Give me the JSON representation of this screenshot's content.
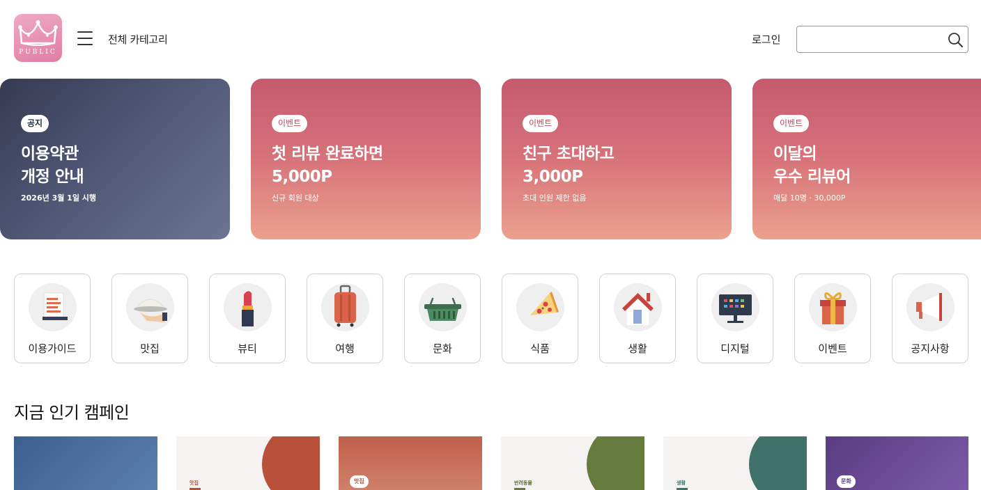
{
  "header": {
    "logo_text": "PUBLIC",
    "category_label": "전체 카테고리",
    "login_label": "로그인",
    "search_placeholder": ""
  },
  "banners": [
    {
      "type": "notice",
      "badge": "공지",
      "title_line1": "이용약관",
      "title_line2": "개정 안내",
      "subtitle": "2026년 3월 1일 시행"
    },
    {
      "type": "event",
      "badge": "이벤트",
      "title_line1": "첫 리뷰 완료하면",
      "title_line2": "5,000P",
      "subtitle": "신규 회원 대상"
    },
    {
      "type": "event",
      "badge": "이벤트",
      "title_line1": "친구 초대하고",
      "title_line2": "3,000P",
      "subtitle": "초대 인원 제한 없음"
    },
    {
      "type": "event",
      "badge": "이벤트",
      "title_line1": "이달의",
      "title_line2": "우수 리뷰어",
      "subtitle": "매달 10명 · 30,000P"
    }
  ],
  "categories": [
    {
      "label": "이용가이드",
      "icon": "guide-icon"
    },
    {
      "label": "맛집",
      "icon": "dish-icon"
    },
    {
      "label": "뷰티",
      "icon": "lipstick-icon"
    },
    {
      "label": "여행",
      "icon": "suitcase-icon"
    },
    {
      "label": "문화",
      "icon": "basket-icon"
    },
    {
      "label": "식품",
      "icon": "pizza-icon"
    },
    {
      "label": "생활",
      "icon": "house-icon"
    },
    {
      "label": "디지털",
      "icon": "monitor-icon"
    },
    {
      "label": "이벤트",
      "icon": "gift-icon"
    },
    {
      "label": "공지사항",
      "icon": "megaphone-icon"
    }
  ],
  "section": {
    "title": "지금 인기 캠페인"
  },
  "campaigns": [
    {
      "tag": ""
    },
    {
      "tag": "맛집"
    },
    {
      "tag": "맛집"
    },
    {
      "tag": "반려동물"
    },
    {
      "tag": "생활"
    },
    {
      "tag": "문화"
    }
  ],
  "colors": {
    "logo": "#e58db0",
    "event_banner_top": "#c55a6e",
    "event_banner_bottom": "#eba18e",
    "notice_banner": "#4e5674"
  }
}
